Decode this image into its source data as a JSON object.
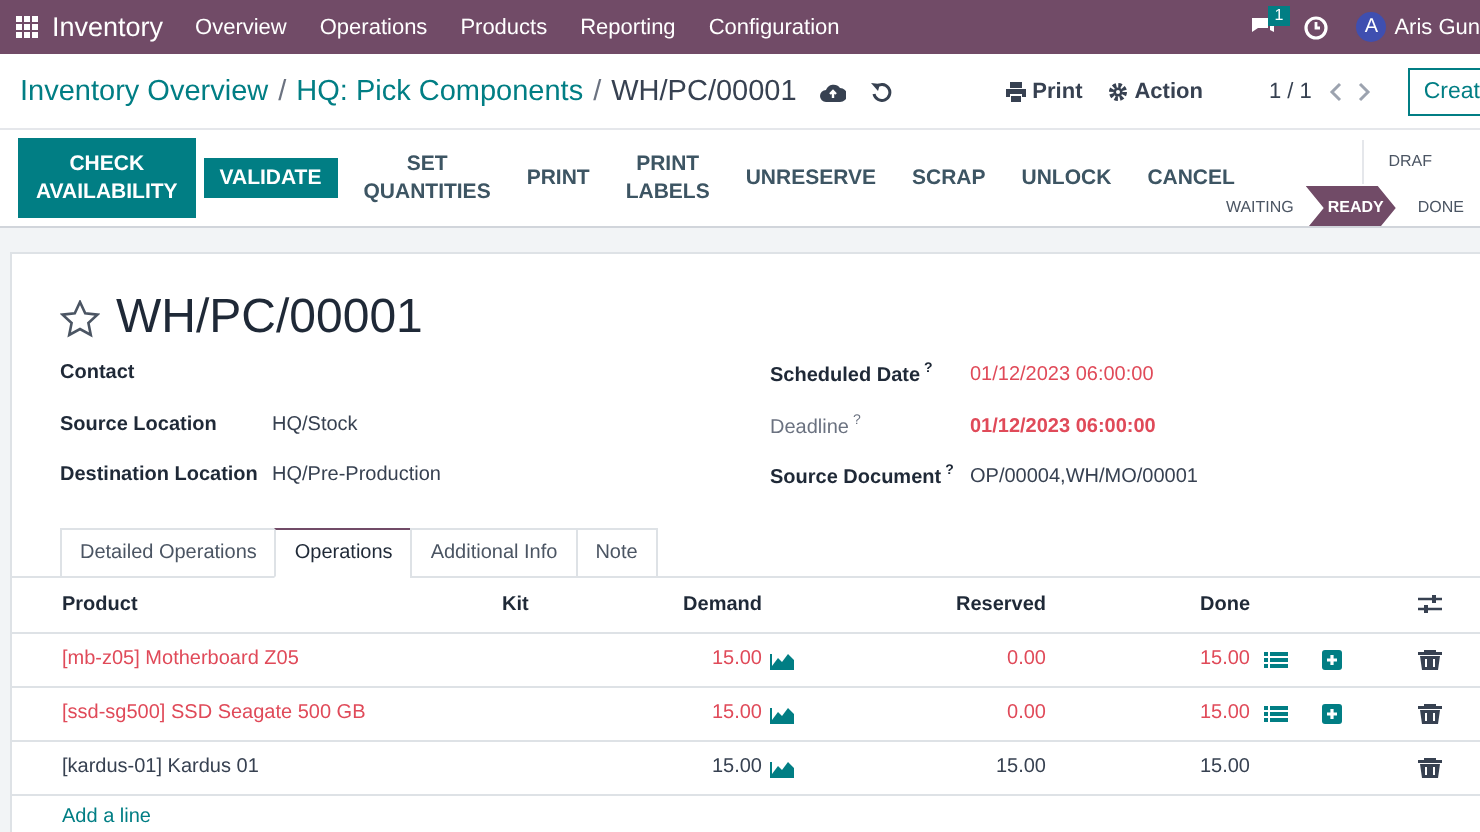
{
  "navbar": {
    "app": "Inventory",
    "menus": [
      "Overview",
      "Operations",
      "Products",
      "Reporting",
      "Configuration"
    ],
    "chat_badge": "1",
    "user_initial": "A",
    "user_name": "Aris Gun"
  },
  "control_panel": {
    "breadcrumbs": [
      "Inventory Overview",
      "HQ: Pick Components",
      "WH/PC/00001"
    ],
    "print": "Print",
    "action": "Action",
    "pager": "1 / 1",
    "create": "Creat",
    "separator": "/"
  },
  "actions": [
    {
      "label": "CHECK AVAILABILITY",
      "kind": "primary"
    },
    {
      "label": "VALIDATE",
      "kind": "primary"
    },
    {
      "label": "SET QUANTITIES",
      "kind": "secondary"
    },
    {
      "label": "PRINT",
      "kind": "secondary"
    },
    {
      "label": "PRINT LABELS",
      "kind": "secondary"
    },
    {
      "label": "UNRESERVE",
      "kind": "secondary"
    },
    {
      "label": "SCRAP",
      "kind": "secondary"
    },
    {
      "label": "UNLOCK",
      "kind": "secondary"
    },
    {
      "label": "CANCEL",
      "kind": "secondary"
    }
  ],
  "stages": [
    {
      "label": "DRAF",
      "selected": false
    },
    {
      "label": "WAITING",
      "selected": false
    },
    {
      "label": "READY",
      "selected": true
    },
    {
      "label": "DONE",
      "selected": false
    }
  ],
  "form": {
    "title": "WH/PC/00001",
    "starred": false,
    "left_fields": [
      {
        "label": "Contact"
      },
      {
        "label": "Source Location",
        "value": "HQ/Stock"
      },
      {
        "label": "Destination Location",
        "value": "HQ/Pre-Production"
      }
    ],
    "right_fields": [
      {
        "label": "Scheduled Date",
        "help": "?",
        "value": "01/12/2023 06:00:00",
        "kind": "late"
      },
      {
        "label": "Deadline",
        "help": "?",
        "value": "01/12/2023 06:00:00",
        "kind": "overdue"
      },
      {
        "label": "Source Document",
        "help": "?",
        "value": "OP/00004,WH/MO/00001",
        "kind": "plain"
      }
    ]
  },
  "tabs": [
    {
      "label": "Detailed Operations",
      "selected": false
    },
    {
      "label": "Operations",
      "selected": true
    },
    {
      "label": "Additional Info",
      "selected": false
    },
    {
      "label": "Note",
      "selected": false
    }
  ],
  "table": {
    "columns": [
      "Product",
      "Kit",
      "Demand",
      "Reserved",
      "Done"
    ],
    "rows": [
      {
        "product": "[mb-z05] Motherboard Z05",
        "demand": "15.00",
        "reserved": "0.00",
        "done": "15.00",
        "late": true,
        "details": true
      },
      {
        "product": "[ssd-sg500] SSD Seagate 500 GB",
        "demand": "15.00",
        "reserved": "0.00",
        "done": "15.00",
        "late": true,
        "details": true
      },
      {
        "product": "[kardus-01] Kardus 01",
        "demand": "15.00",
        "reserved": "15.00",
        "done": "15.00",
        "late": false,
        "details": false
      }
    ],
    "add_line": "Add a line"
  }
}
